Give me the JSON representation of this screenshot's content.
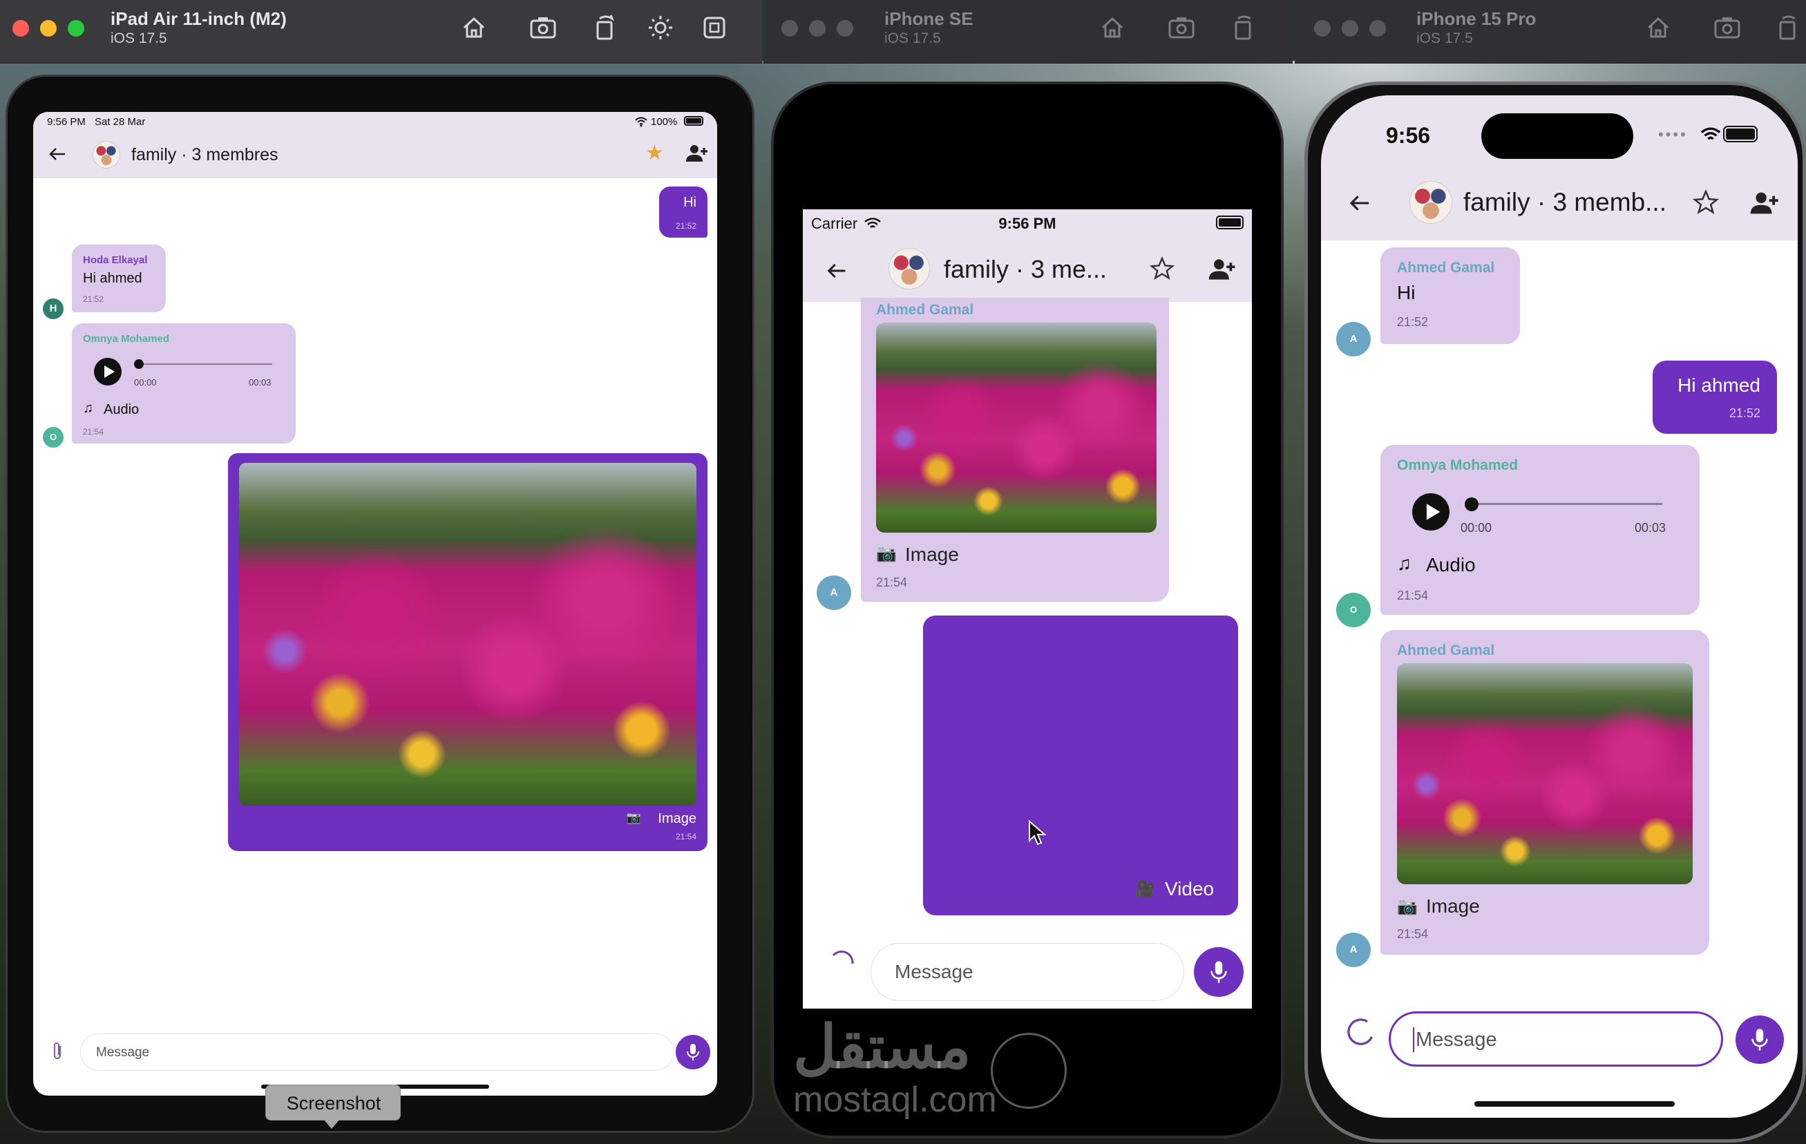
{
  "simulators": [
    {
      "name": "iPad Air 11-inch (M2)",
      "os": "iOS 17.5"
    },
    {
      "name": "iPhone SE",
      "os": "iOS 17.5"
    },
    {
      "name": "iPhone 15 Pro",
      "os": "iOS 17.5"
    }
  ],
  "ipad": {
    "status": {
      "time": "9:56 PM",
      "date": "Sat 28 Mar",
      "battery": "100%"
    },
    "header": {
      "title": "family · 3 membres"
    },
    "messages": {
      "hi": {
        "text": "Hi",
        "time": "21:52"
      },
      "hoda": {
        "sender": "Hoda Elkayal",
        "text": "Hi ahmed",
        "time": "21:52",
        "avatar": "H"
      },
      "omnya": {
        "sender": "Omnya Mohamed",
        "start": "00:00",
        "end": "00:03",
        "label": "Audio",
        "time": "21:54",
        "avatar": "O"
      },
      "image": {
        "label": "Image",
        "time": "21:54"
      }
    },
    "composer": {
      "placeholder": "Message"
    }
  },
  "iphone_se": {
    "status": {
      "carrier": "Carrier",
      "time": "9:56 PM"
    },
    "header": {
      "title": "family · 3 me..."
    },
    "messages": {
      "ahmed": {
        "sender": "Ahmed Gamal",
        "label": "Image",
        "time": "21:54",
        "avatar": "A"
      },
      "video": {
        "label": "Video"
      }
    },
    "composer": {
      "placeholder": "Message"
    }
  },
  "iphone_15": {
    "status": {
      "time": "9:56"
    },
    "header": {
      "title": "family · 3 memb..."
    },
    "messages": {
      "ahmed1": {
        "sender": "Ahmed Gamal",
        "text": "Hi",
        "time": "21:52",
        "avatar": "A"
      },
      "hiahmed": {
        "text": "Hi ahmed",
        "time": "21:52"
      },
      "omnya": {
        "sender": "Omnya Mohamed",
        "start": "00:00",
        "end": "00:03",
        "label": "Audio",
        "time": "21:54",
        "avatar": "O"
      },
      "ahmed2": {
        "sender": "Ahmed Gamal",
        "label": "Image",
        "time": "21:54",
        "avatar": "A"
      }
    },
    "composer": {
      "placeholder": "Message"
    }
  },
  "tooltip": "Screenshot",
  "watermark": {
    "arabic": "مستقل",
    "latin": "mostaql.com"
  },
  "colors": {
    "outgoing": "#7030bf",
    "incoming": "#dcc8ea",
    "header_bg": "#e8e3ee",
    "sender_green": "#4fb59a",
    "sender_purple": "#7a3fc0",
    "sender_blue": "#6ba7c4",
    "star": "#e8a53a"
  }
}
